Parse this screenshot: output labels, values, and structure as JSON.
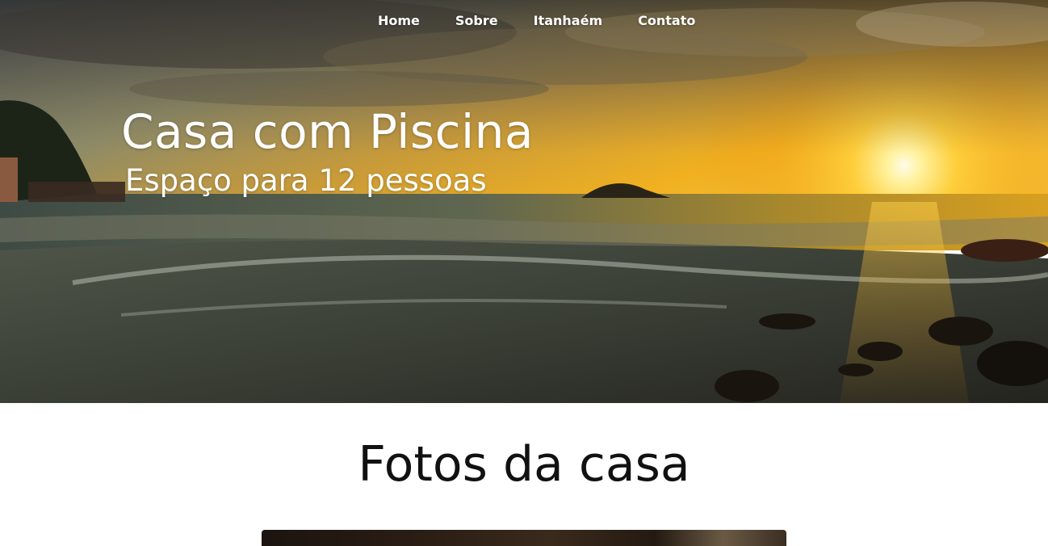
{
  "nav": {
    "items": [
      {
        "label": "Home"
      },
      {
        "label": "Sobre"
      },
      {
        "label": "Itanhaém"
      },
      {
        "label": "Contato"
      }
    ]
  },
  "hero": {
    "title": "Casa com Piscina",
    "subtitle": "Espaço para 12 pessoas",
    "image": "sunset-beach-photo"
  },
  "gallery": {
    "title": "Fotos da casa",
    "image": "house-photo"
  },
  "colors": {
    "nav_text": "#ffffff",
    "hero_text": "#ffffff",
    "section_title": "#111111",
    "page_background": "#ffffff"
  }
}
